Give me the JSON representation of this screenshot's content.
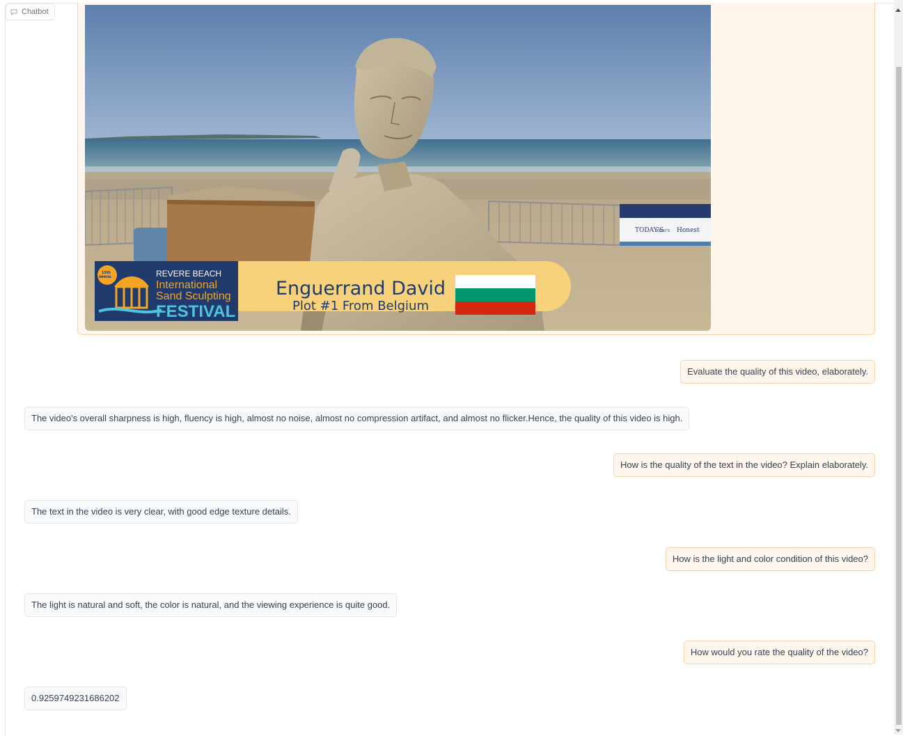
{
  "chatbot": {
    "label": "Chatbot",
    "icon": "chat-bubble-icon"
  },
  "video": {
    "overlay": {
      "badge_edition": "15th",
      "badge_annual": "ANNUAL",
      "event_line1": "REVERE BEACH",
      "event_line2": "International",
      "event_line3": "Sand Sculpting",
      "event_line4": "FESTIVAL",
      "artist_name": "Enguerrand David",
      "plot_text": "Plot #1 From Belgium"
    },
    "banner_sponsors": [
      "TODAY'S",
      "KELLY'S",
      "Honest"
    ]
  },
  "messages": [
    {
      "role": "user",
      "text": "Evaluate the quality of this video, elaborately."
    },
    {
      "role": "bot",
      "text": "The video's overall sharpness is high, fluency is high, almost no noise, almost no compression artifact, and almost no flicker.Hence, the quality of this video is high."
    },
    {
      "role": "user",
      "text": "How is the quality of the text in the video? Explain elaborately."
    },
    {
      "role": "bot",
      "text": "The text in the video is very clear, with good edge texture details."
    },
    {
      "role": "user",
      "text": "How is the light and color condition of this video?"
    },
    {
      "role": "bot",
      "text": "The light is natural and soft, the color is natural, and the viewing experience is quite good."
    },
    {
      "role": "user",
      "text": "How would you rate the quality of the video?"
    },
    {
      "role": "bot",
      "text": "0.9259749231686202"
    }
  ],
  "colors": {
    "user_bubble_bg": "#fff6ee",
    "user_bubble_border": "#f8d3aa",
    "bot_bubble_bg": "#f9fafb",
    "bot_bubble_border": "#e5e7eb",
    "flag_white": "#ffffff",
    "flag_green": "#00966e",
    "flag_red": "#d62612"
  }
}
